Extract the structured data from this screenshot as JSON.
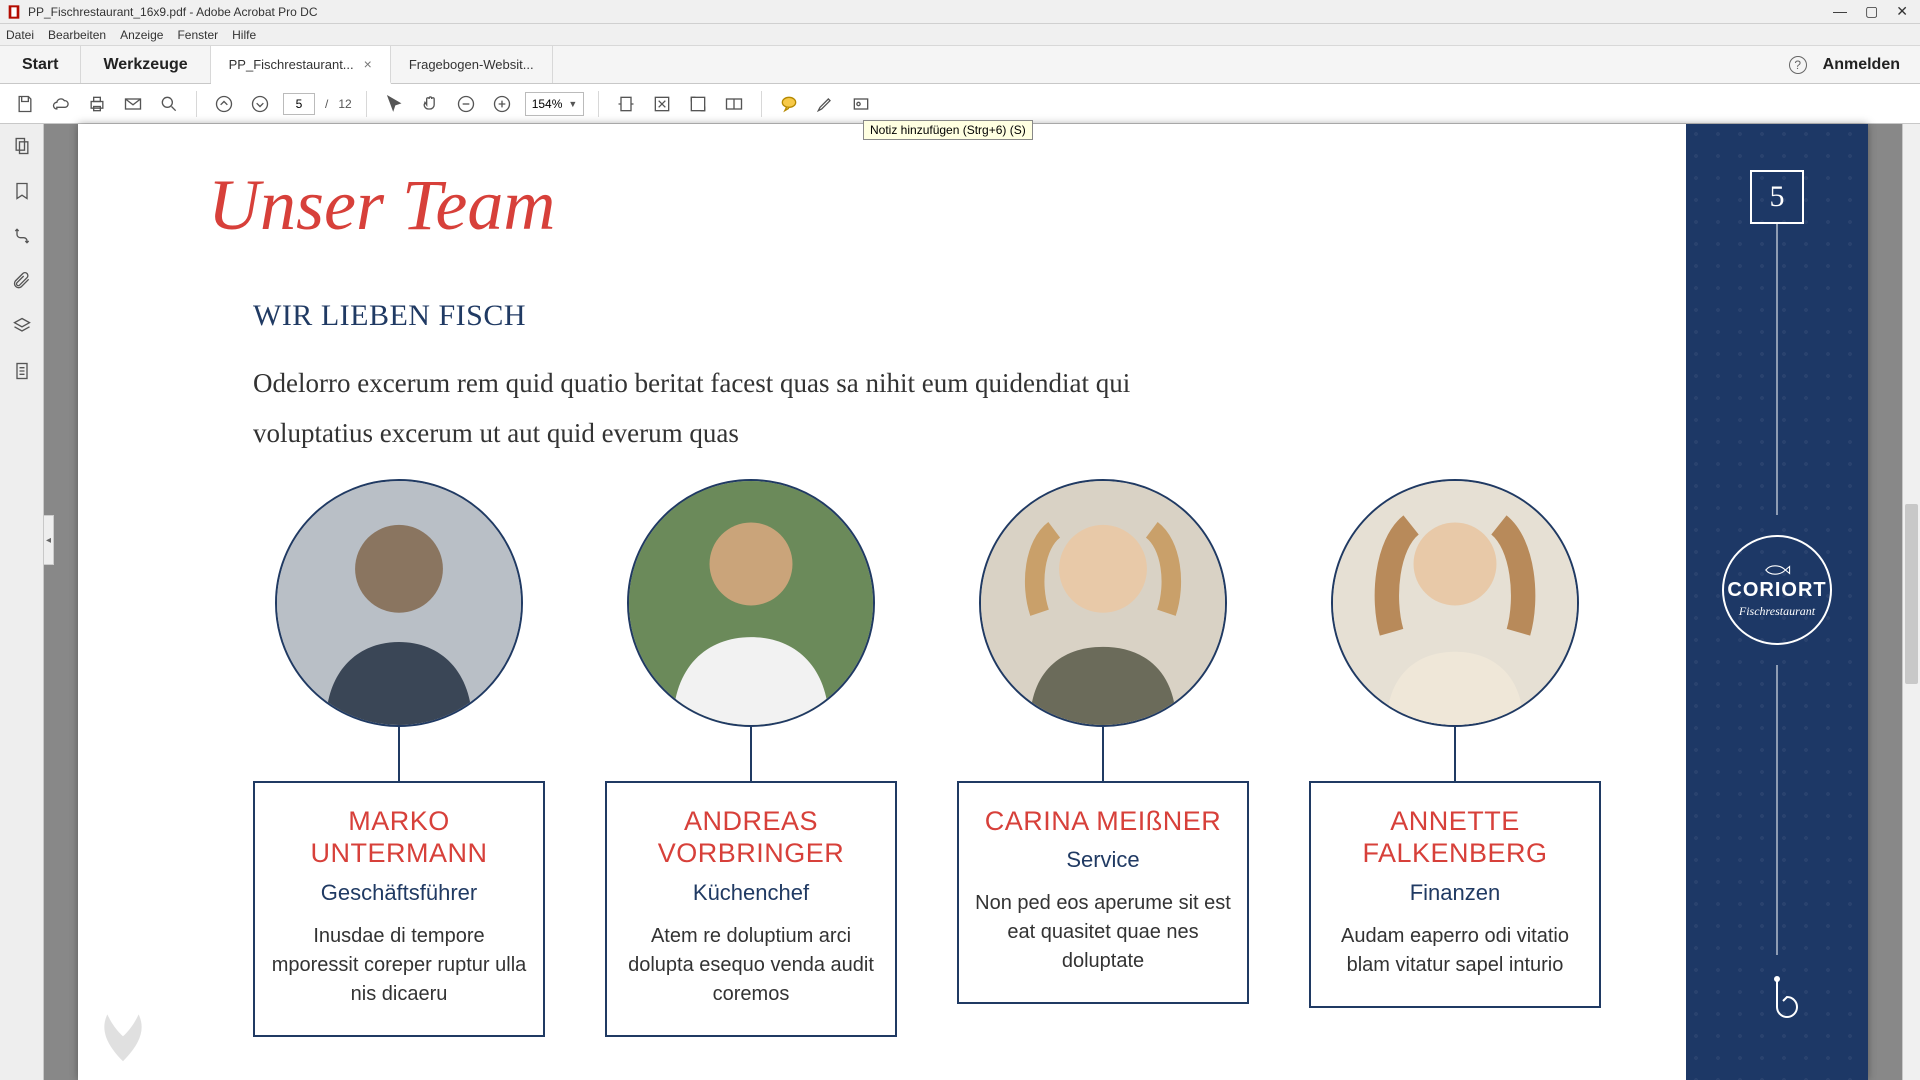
{
  "window": {
    "title": "PP_Fischrestaurant_16x9.pdf - Adobe Acrobat Pro DC"
  },
  "menu": {
    "items": [
      "Datei",
      "Bearbeiten",
      "Anzeige",
      "Fenster",
      "Hilfe"
    ]
  },
  "tabs": {
    "start": "Start",
    "tools": "Werkzeuge",
    "docs": [
      {
        "label": "PP_Fischrestaurant...",
        "active": true
      },
      {
        "label": "Fragebogen-Websit...",
        "active": false
      }
    ],
    "signin": "Anmelden"
  },
  "toolbar": {
    "page_current": "5",
    "page_sep": "/",
    "page_total": "12",
    "zoom": "154%",
    "tooltip": "Notiz hinzufügen (Strg+6) (S)"
  },
  "doc": {
    "heading": "Unser Team",
    "subhead": "WIR LIEBEN FISCH",
    "para": "Odelorro excerum rem quid quatio beritat facest quas sa nihit eum quidendiat qui voluptatius excerum ut aut quid everum quas",
    "page_number": "5",
    "brand": "CORIORT",
    "brand_sub": "Fischrestaurant",
    "members": [
      {
        "name": "MARKO UNTERMANN",
        "role": "Geschäftsführer",
        "blurb": "Inusdae di tempore mporessit coreper ruptur ulla nis dicaeru"
      },
      {
        "name": "ANDREAS VORBRINGER",
        "role": "Küchenchef",
        "blurb": "Atem re doluptium arci dolupta esequo venda audit coremos"
      },
      {
        "name": "CARINA MEIßNER",
        "role": "Service",
        "blurb": "Non ped eos aperume sit est eat quasitet quae nes doluptate"
      },
      {
        "name": "ANNETTE FALKENBERG",
        "role": "Finanzen",
        "blurb": "Audam eaperro odi vitatio blam vitatur sapel inturio"
      }
    ]
  }
}
